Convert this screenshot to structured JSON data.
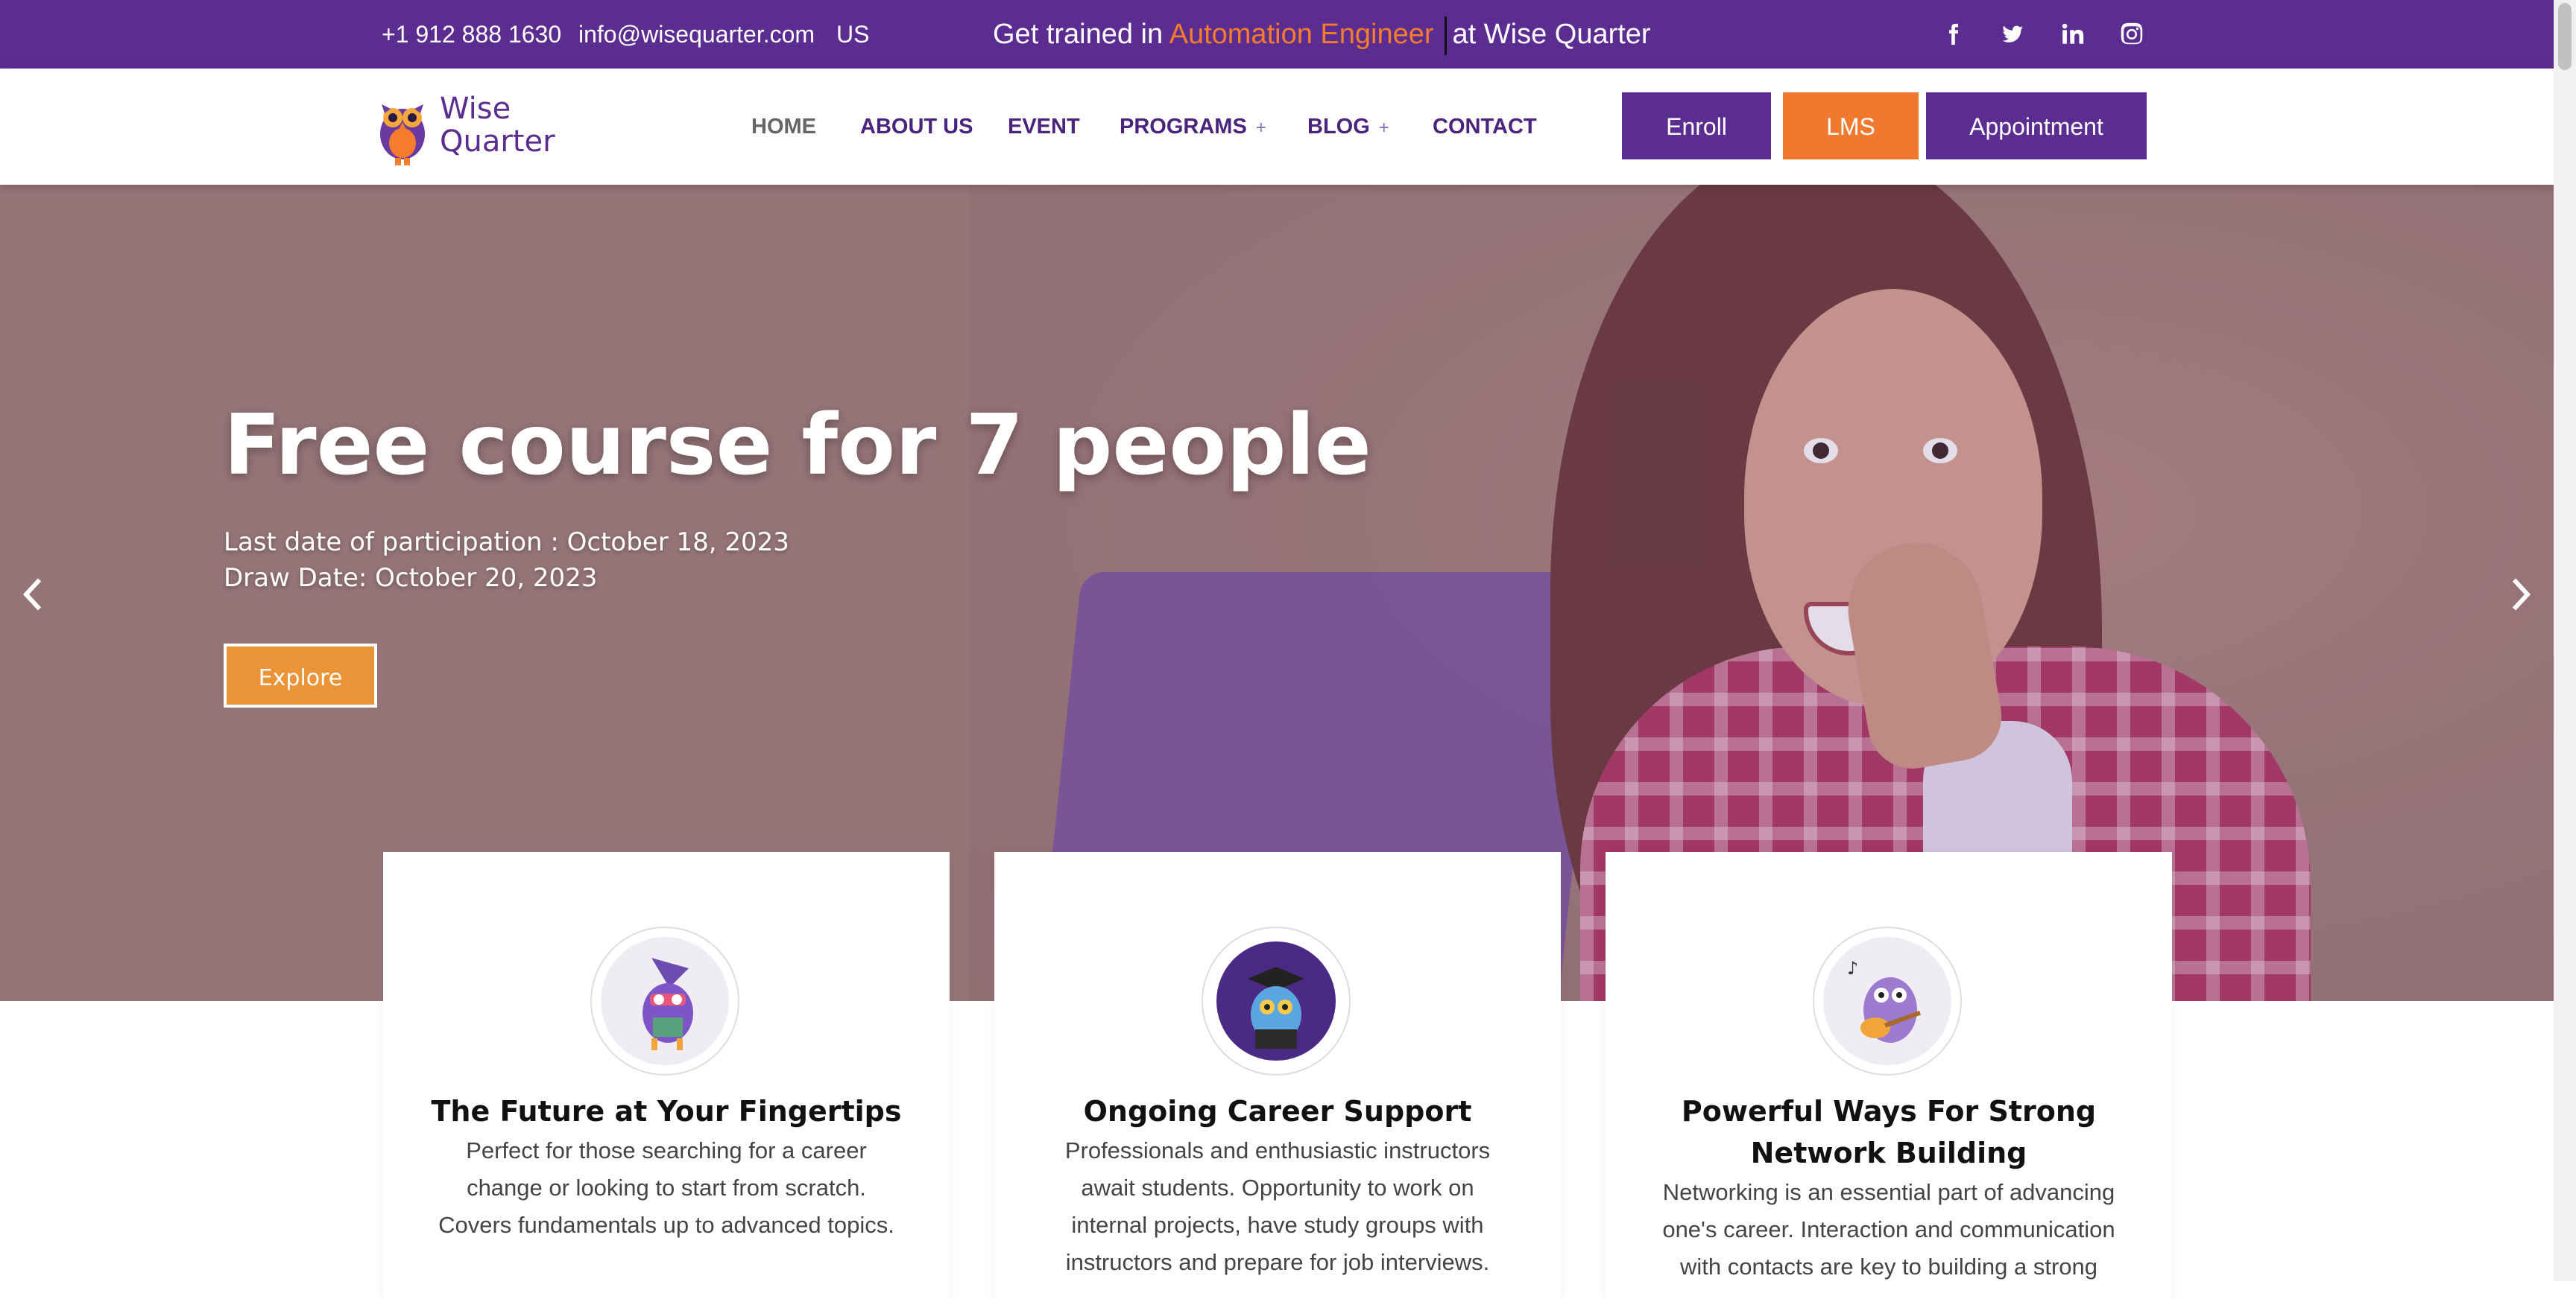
{
  "topbar": {
    "phone": "+1 912 888 1630",
    "email": "info@wisequarter.com",
    "region": "US",
    "promo_prefix": "Get trained in",
    "promo_highlight": "Automation Engineer",
    "promo_suffix": "at Wise Quarter",
    "social": [
      "facebook-icon",
      "twitter-icon",
      "linkedin-icon",
      "instagram-icon"
    ]
  },
  "header": {
    "logo_line1": "Wise",
    "logo_line2": "Quarter",
    "nav": {
      "home": "HOME",
      "about": "ABOUT US",
      "event": "EVENT",
      "programs": "PROGRAMS",
      "blog": "BLOG",
      "contact": "CONTACT",
      "plus": "+"
    },
    "buttons": {
      "enroll": "Enroll",
      "lms": "LMS",
      "appointment": "Appointment"
    }
  },
  "hero": {
    "title": "Free course for 7 people",
    "line1": "Last date of participation : October 18, 2023",
    "line2": "Draw Date: October 20, 2023",
    "cta": "Explore"
  },
  "cards": [
    {
      "title": "The Future at Your Fingertips",
      "text": "Perfect for those searching for a career change or looking to start from scratch. Covers fundamentals up to advanced topics."
    },
    {
      "title": "Ongoing Career Support",
      "text": "Professionals and enthusiastic instructors await students. Opportunity to work on internal projects, have study groups with instructors and prepare for job interviews."
    },
    {
      "title": "Powerful Ways For Strong Network Building",
      "text": "Networking is an essential part of advancing one's career. Interaction and communication with contacts are key to building a strong"
    }
  ],
  "colors": {
    "brand_purple": "#5b2d91",
    "accent_orange": "#f47c2c",
    "lms_orange": "#f0792f",
    "explore_orange": "#eb9437"
  }
}
